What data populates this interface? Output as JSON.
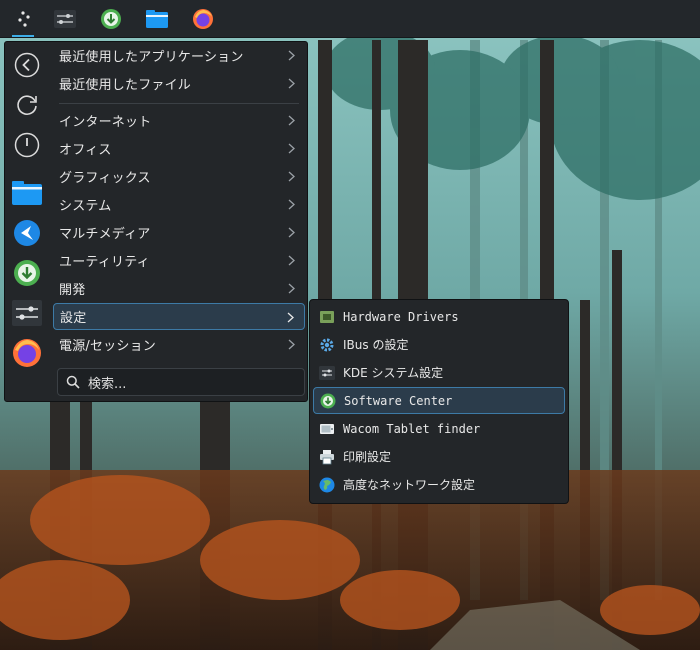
{
  "panel": {
    "items": [
      {
        "name": "application-launcher"
      },
      {
        "name": "system-settings"
      },
      {
        "name": "software-center"
      },
      {
        "name": "file-manager"
      },
      {
        "name": "firefox"
      }
    ]
  },
  "launcher": {
    "sidebar": [
      {
        "icon": "back-icon"
      },
      {
        "icon": "refresh-icon"
      },
      {
        "icon": "power-icon"
      },
      {
        "icon": "folder-icon"
      },
      {
        "icon": "kde-connect-icon"
      },
      {
        "icon": "download-icon"
      },
      {
        "icon": "settings-sliders-icon"
      },
      {
        "icon": "firefox-icon"
      }
    ],
    "items": [
      {
        "label": "最近使用したアプリケーション"
      },
      {
        "label": "最近使用したファイル"
      },
      {
        "label": "インターネット"
      },
      {
        "label": "オフィス"
      },
      {
        "label": "グラフィックス"
      },
      {
        "label": "システム"
      },
      {
        "label": "マルチメディア"
      },
      {
        "label": "ユーティリティ"
      },
      {
        "label": "開発"
      },
      {
        "label": "設定"
      },
      {
        "label": "電源/セッション"
      }
    ],
    "selected": "設定",
    "search": {
      "placeholder": "検索..."
    }
  },
  "submenu": {
    "items": [
      {
        "label": "Hardware Drivers",
        "icon": "hardware-drivers-icon"
      },
      {
        "label": "IBus の設定",
        "icon": "gear-icon"
      },
      {
        "label": "KDE システム設定",
        "icon": "kde-settings-icon"
      },
      {
        "label": "Software Center",
        "icon": "software-center-icon"
      },
      {
        "label": "Wacom Tablet finder",
        "icon": "tablet-icon"
      },
      {
        "label": "印刷設定",
        "icon": "printer-icon"
      },
      {
        "label": "高度なネットワーク設定",
        "icon": "globe-icon"
      }
    ],
    "selected": "Software Center"
  },
  "colors": {
    "accent": "#3daee9",
    "menu_bg": "#232629",
    "selected_bg": "#2b3c4b",
    "selected_border": "#3d7aa6"
  }
}
